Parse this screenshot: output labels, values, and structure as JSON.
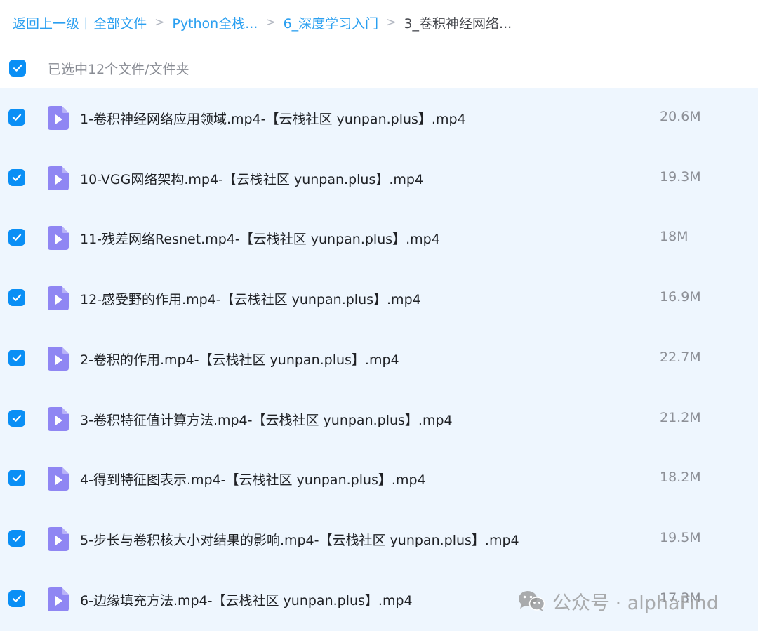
{
  "breadcrumb": {
    "back": "返回上一级",
    "items": [
      "全部文件",
      "Python全栈...",
      "6_深度学习入门"
    ],
    "separator": ">",
    "current": "3_卷积神经网络..."
  },
  "selection": {
    "all_checked": true,
    "label": "已选中12个文件/文件夹"
  },
  "files": [
    {
      "name": "1-卷积神经网络应用领域.mp4-【云栈社区 yunpan.plus】.mp4",
      "size": "20.6M",
      "checked": true,
      "icon": "video-file-icon"
    },
    {
      "name": "10-VGG网络架构.mp4-【云栈社区 yunpan.plus】.mp4",
      "size": "19.3M",
      "checked": true,
      "icon": "video-file-icon"
    },
    {
      "name": "11-残差网络Resnet.mp4-【云栈社区 yunpan.plus】.mp4",
      "size": "18M",
      "checked": true,
      "icon": "video-file-icon"
    },
    {
      "name": "12-感受野的作用.mp4-【云栈社区 yunpan.plus】.mp4",
      "size": "16.9M",
      "checked": true,
      "icon": "video-file-icon"
    },
    {
      "name": "2-卷积的作用.mp4-【云栈社区 yunpan.plus】.mp4",
      "size": "22.7M",
      "checked": true,
      "icon": "video-file-icon"
    },
    {
      "name": "3-卷积特征值计算方法.mp4-【云栈社区 yunpan.plus】.mp4",
      "size": "21.2M",
      "checked": true,
      "icon": "video-file-icon"
    },
    {
      "name": "4-得到特征图表示.mp4-【云栈社区 yunpan.plus】.mp4",
      "size": "18.2M",
      "checked": true,
      "icon": "video-file-icon"
    },
    {
      "name": "5-步长与卷积核大小对结果的影响.mp4-【云栈社区 yunpan.plus】.mp4",
      "size": "19.5M",
      "checked": true,
      "icon": "video-file-icon"
    },
    {
      "name": "6-边缘填充方法.mp4-【云栈社区 yunpan.plus】.mp4",
      "size": "17.3M",
      "checked": true,
      "icon": "video-file-icon"
    }
  ],
  "watermark": {
    "text": "公众号 · alphaFind",
    "icon": "wechat-icon"
  },
  "colors": {
    "accent": "#0a8ff5",
    "link": "#2a9ff0",
    "list_background": "#eef6fe",
    "file_icon": "#8f86f3"
  }
}
